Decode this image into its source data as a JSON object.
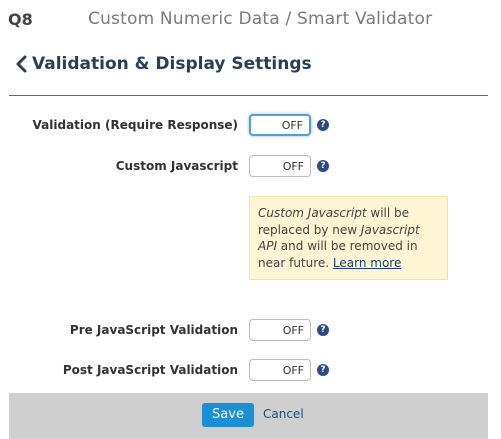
{
  "question": {
    "number": "Q8",
    "title": "Custom Numeric Data / Smart Validator"
  },
  "panel": {
    "back_icon": "chevron-left-icon",
    "title": "Validation & Display Settings"
  },
  "settings": [
    {
      "label": "Validation (Require Response)",
      "toggle": "OFF",
      "help": "?"
    },
    {
      "label": "Custom Javascript",
      "toggle": "OFF",
      "help": "?"
    },
    {
      "label": "Pre JavaScript Validation",
      "toggle": "OFF",
      "help": "?"
    },
    {
      "label": "Post JavaScript Validation",
      "toggle": "OFF",
      "help": "?"
    }
  ],
  "notice": {
    "part1": "Custom Javascript",
    "part2": " will be replaced by new ",
    "part3": "Javascript API",
    "part4": " and will be removed in near future. ",
    "link": "Learn more"
  },
  "footer": {
    "save_label": "Save",
    "cancel_label": "Cancel"
  },
  "colors": {
    "accent": "#1a8fd6",
    "notice_bg": "#fdf5d3",
    "footer_bg": "#cfcfcf",
    "help_icon": "#2a4a8a"
  }
}
